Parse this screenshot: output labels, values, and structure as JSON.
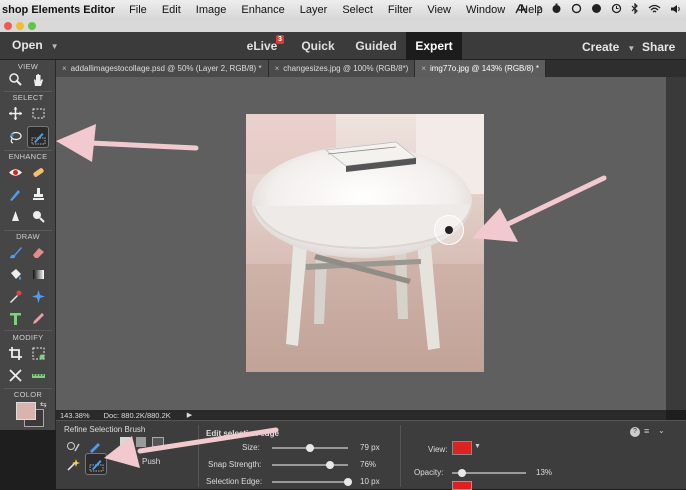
{
  "menubar": {
    "app_name": "shop Elements Editor",
    "items": [
      "File",
      "Edit",
      "Image",
      "Enhance",
      "Layer",
      "Select",
      "Filter",
      "View",
      "Window",
      "Help"
    ],
    "status_number": "2"
  },
  "topbar": {
    "open_label": "Open",
    "modes": [
      "eLive",
      "Quick",
      "Guided",
      "Expert"
    ],
    "elive_badge": "3",
    "active_mode": "Expert",
    "create_label": "Create",
    "share_label": "Share"
  },
  "tabs": [
    {
      "label": "addallimagestocollage.psd @ 50% (Layer 2, RGB/8) *",
      "active": false
    },
    {
      "label": "changesizes.jpg @ 100% (RGB/8*)",
      "active": false
    },
    {
      "label": "img77o.jpg @ 143% (RGB/8) *",
      "active": true
    }
  ],
  "toolbox": {
    "sections": [
      "VIEW",
      "SELECT",
      "ENHANCE",
      "DRAW",
      "MODIFY",
      "COLOR"
    ],
    "tools": [
      {
        "name": "zoom-tool-icon",
        "section": "VIEW"
      },
      {
        "name": "hand-tool-icon",
        "section": "VIEW"
      },
      {
        "name": "move-tool-icon",
        "section": "SELECT"
      },
      {
        "name": "marquee-tool-icon",
        "section": "SELECT"
      },
      {
        "name": "lasso-tool-icon",
        "section": "SELECT"
      },
      {
        "name": "refine-selection-brush-icon",
        "section": "SELECT",
        "selected": true
      },
      {
        "name": "red-eye-tool-icon",
        "section": "ENHANCE"
      },
      {
        "name": "healing-brush-icon",
        "section": "ENHANCE"
      },
      {
        "name": "smart-brush-icon",
        "section": "ENHANCE"
      },
      {
        "name": "clone-stamp-icon",
        "section": "ENHANCE"
      },
      {
        "name": "blur-tool-icon",
        "section": "ENHANCE"
      },
      {
        "name": "sponge-tool-icon",
        "section": "ENHANCE"
      },
      {
        "name": "brush-tool-icon",
        "section": "DRAW"
      },
      {
        "name": "eraser-tool-icon",
        "section": "DRAW"
      },
      {
        "name": "paint-bucket-icon",
        "section": "DRAW"
      },
      {
        "name": "gradient-tool-icon",
        "section": "DRAW"
      },
      {
        "name": "eyedropper-icon",
        "section": "DRAW"
      },
      {
        "name": "custom-shape-icon",
        "section": "DRAW"
      },
      {
        "name": "type-tool-icon",
        "section": "DRAW"
      },
      {
        "name": "pencil-tool-icon",
        "section": "DRAW"
      },
      {
        "name": "crop-tool-icon",
        "section": "MODIFY"
      },
      {
        "name": "recompose-tool-icon",
        "section": "MODIFY"
      },
      {
        "name": "content-aware-move-icon",
        "section": "MODIFY"
      },
      {
        "name": "straighten-tool-icon",
        "section": "MODIFY"
      }
    ],
    "foreground_color": "#d9b3ae",
    "background_color": "#3a3a3a"
  },
  "statusbar": {
    "zoom": "143.38%",
    "doc": "Doc: 880.2K/880.2K"
  },
  "options": {
    "tool_name": "Refine Selection Brush",
    "push_label": "Push",
    "section_title": "Edit selection edge",
    "size_label": "Size:",
    "size_value": "79 px",
    "size_level": 0.5,
    "snap_label": "Snap Strength:",
    "snap_value": "76%",
    "snap_level": 0.76,
    "edge_label": "Selection Edge:",
    "edge_value": "10 px",
    "edge_level": 1.0,
    "view_label": "View:",
    "opacity_label": "Opacity:",
    "opacity_value": "13%",
    "opacity_level": 0.13,
    "overlay_color": "#e02020"
  },
  "colors": {
    "accent_active_mode": "#1c1c1c",
    "annotation_arrow": "#f2c9cf"
  }
}
